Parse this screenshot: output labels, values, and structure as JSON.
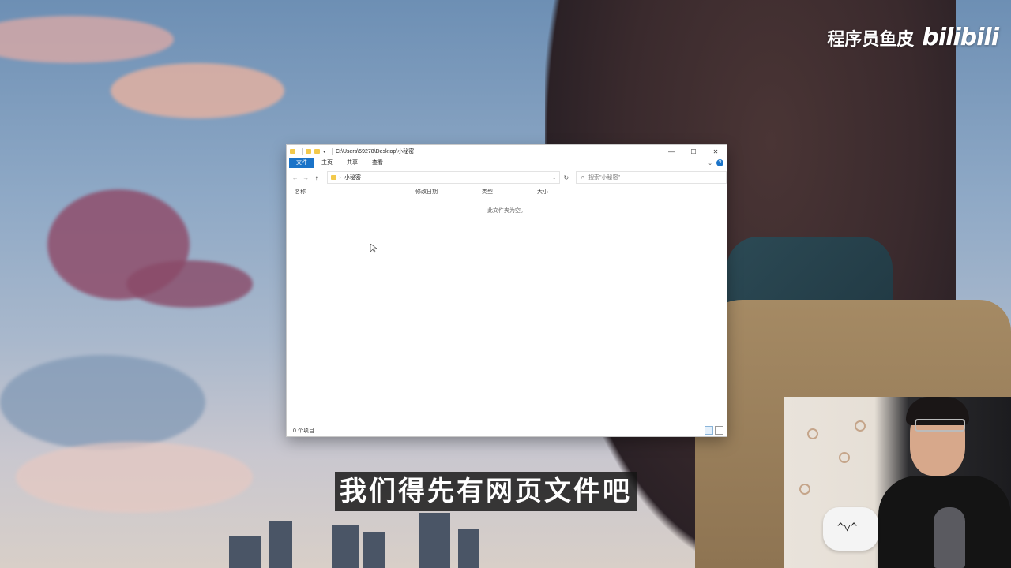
{
  "watermark": {
    "author": "程序员鱼皮",
    "brand": "bilibili"
  },
  "explorer": {
    "title_path": "C:\\Users\\59278\\Desktop\\小秘密",
    "qa_arrow": "▾",
    "window_controls": {
      "minimize": "—",
      "maximize": "☐",
      "close": "✕"
    },
    "ribbon_tabs": [
      "文件",
      "主页",
      "共享",
      "查看"
    ],
    "nav": {
      "back": "←",
      "forward": "→",
      "up": "↑"
    },
    "address": {
      "separator": "›",
      "folder": "小秘密",
      "dropdown": "⌄"
    },
    "refresh": "↻",
    "search": {
      "placeholder": "搜索\"小秘密\"",
      "icon": "search-icon"
    },
    "columns": [
      "名称",
      "修改日期",
      "类型",
      "大小"
    ],
    "empty_message": "此文件夹为空。",
    "status": "0 个项目"
  },
  "webcam": {
    "plush_face": "^▽^"
  },
  "subtitle": "我们得先有网页文件吧"
}
